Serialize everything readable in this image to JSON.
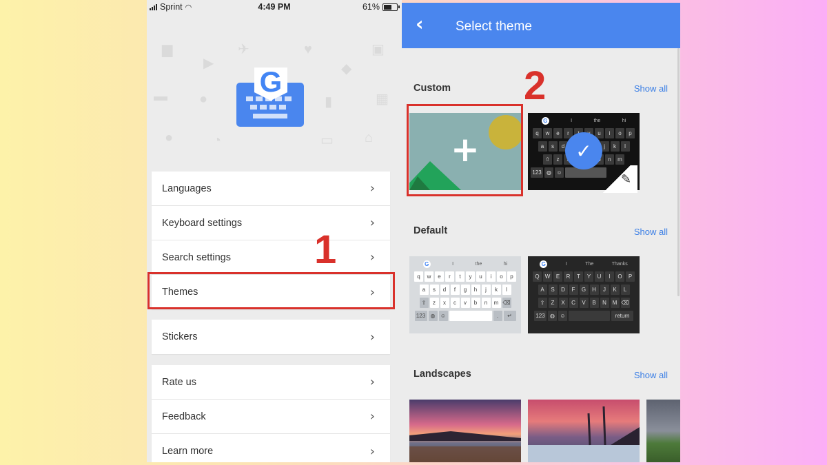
{
  "status_bar": {
    "carrier": "Sprint",
    "time": "4:49 PM",
    "battery": "61%"
  },
  "settings_menu": {
    "group1": [
      {
        "label": "Languages"
      },
      {
        "label": "Keyboard settings"
      },
      {
        "label": "Search settings"
      },
      {
        "label": "Themes"
      }
    ],
    "group2": [
      {
        "label": "Stickers"
      }
    ],
    "group3": [
      {
        "label": "Rate us"
      },
      {
        "label": "Feedback"
      },
      {
        "label": "Learn more"
      }
    ],
    "chevron": "›"
  },
  "annotations": {
    "step1": "1",
    "step2": "2",
    "highlight_color": "#d9312b"
  },
  "select_theme": {
    "title": "Select theme",
    "back_icon": "back-arrow-icon",
    "accent_color": "#4a86ee",
    "sections": [
      {
        "title": "Custom",
        "show_all": "Show all"
      },
      {
        "title": "Default",
        "show_all": "Show all"
      },
      {
        "title": "Landscapes",
        "show_all": "Show all"
      }
    ],
    "add_icon": "+",
    "check_icon": "✓",
    "edit_icon": "✎",
    "keyboard_custom": {
      "suggestions": [
        "I",
        "the",
        "hi"
      ],
      "rows": [
        [
          "q",
          "w",
          "e",
          "r",
          "t",
          "y",
          "u",
          "i",
          "o",
          "p"
        ],
        [
          "a",
          "s",
          "d",
          "f",
          "g",
          "h",
          "j",
          "k",
          "l"
        ],
        [
          "z",
          "x",
          "c",
          "v",
          "b",
          "n",
          "m"
        ]
      ],
      "bottom": [
        "123"
      ]
    },
    "keyboard_light": {
      "suggestions": [
        "I",
        "the",
        "hi"
      ],
      "rows": [
        [
          "q",
          "w",
          "e",
          "r",
          "t",
          "y",
          "u",
          "i",
          "o",
          "p"
        ],
        [
          "a",
          "s",
          "d",
          "f",
          "g",
          "h",
          "j",
          "k",
          "l"
        ],
        [
          "z",
          "x",
          "c",
          "v",
          "b",
          "n",
          "m"
        ]
      ],
      "bottom": [
        "123",
        "."
      ]
    },
    "keyboard_dark": {
      "suggestions": [
        "I",
        "The",
        "Thanks"
      ],
      "rows": [
        [
          "Q",
          "W",
          "E",
          "R",
          "T",
          "Y",
          "U",
          "I",
          "O",
          "P"
        ],
        [
          "A",
          "S",
          "D",
          "F",
          "G",
          "H",
          "J",
          "K",
          "L"
        ],
        [
          "Z",
          "X",
          "C",
          "V",
          "B",
          "N",
          "M"
        ]
      ],
      "bottom": [
        "123",
        "return"
      ]
    }
  }
}
